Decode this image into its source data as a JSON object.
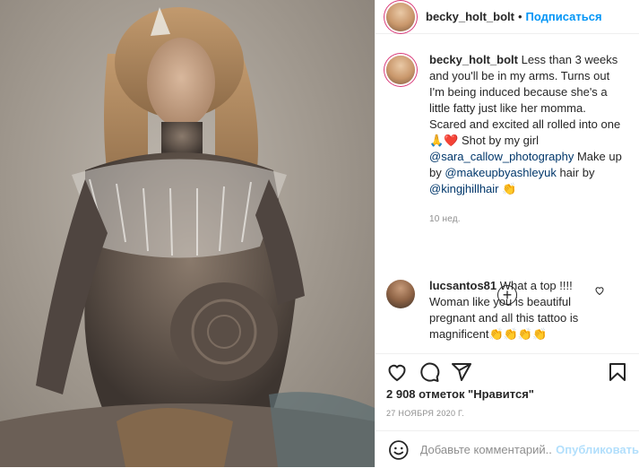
{
  "header": {
    "username": "becky_holt_bolt",
    "separator": "•",
    "follow_label": "Подписаться"
  },
  "caption": {
    "username": "becky_holt_bolt",
    "text_1": "Less than 3 weeks and you'll be in my arms. Turns out I'm being induced because she's a little fatty just like her momma. Scared and excited all rolled into one 🙏❤️ Shot by my girl ",
    "mention_1": "@sara_callow_photography",
    "text_2": " Make up by ",
    "mention_2": "@makeupbyashleyuk",
    "text_3": " hair by ",
    "mention_3": "@kingjhillhair",
    "text_4": " 👏",
    "time": "10 нед."
  },
  "load_more_label": "+",
  "reply": {
    "username": "lucsantos81",
    "text": "What a top !!!! Woman like you is beautiful pregnant and all this tattoo is magnificent👏👏👏👏"
  },
  "actions": {
    "like_icon": "heart-icon",
    "comment_icon": "comment-icon",
    "share_icon": "share-icon",
    "save_icon": "bookmark-icon"
  },
  "likes_text": "2 908 отметок \"Нравится\"",
  "date_text": "27 НОЯБРЯ 2020 Г.",
  "add_comment": {
    "placeholder": "Добавьте комментарий...",
    "post_label": "Опубликовать"
  },
  "colors": {
    "link": "#0095f6",
    "mention": "#00376b",
    "muted": "#8e8e8e",
    "post_disabled": "#b2dffc"
  }
}
